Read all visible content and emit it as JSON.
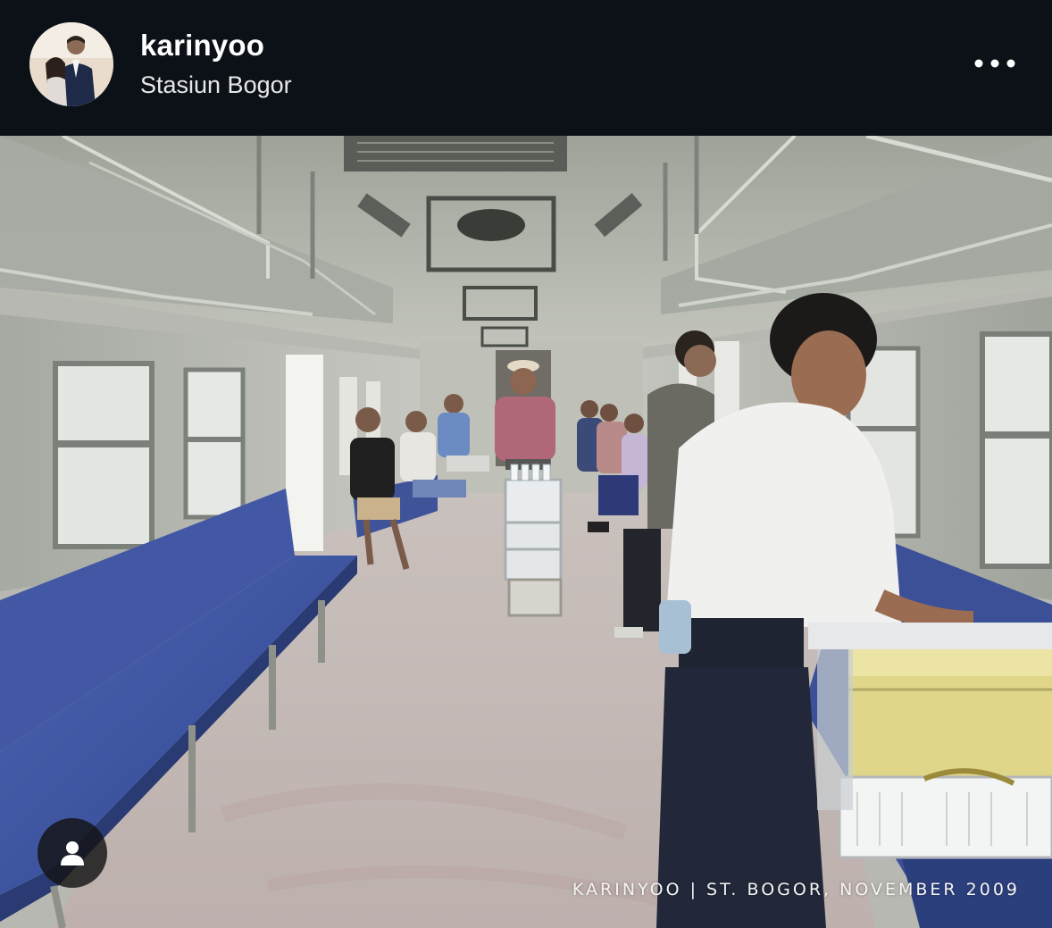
{
  "post": {
    "username": "karinyoo",
    "location": "Stasiun Bogor",
    "watermark": "KARINYOO | ST. BOGOR, NOVEMBER 2009"
  },
  "icons": {
    "more": "more-horizontal-icon",
    "user_tag": "user-tag-icon"
  },
  "colors": {
    "header_bg": "#0c1118",
    "text": "#ffffff",
    "bench_blue": "#3a4f9c"
  }
}
